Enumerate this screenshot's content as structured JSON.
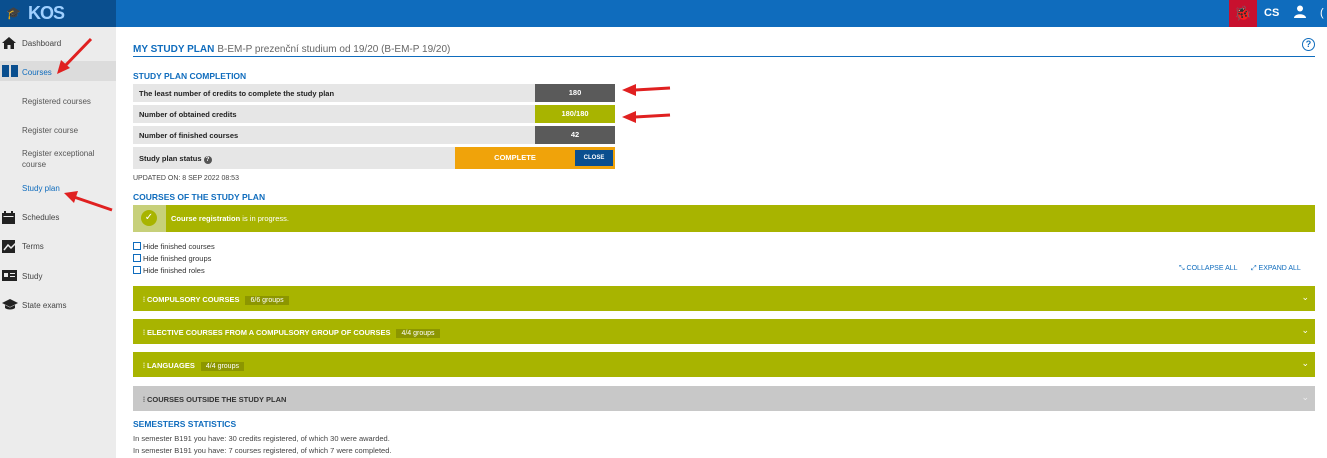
{
  "app": {
    "logo": "KOS"
  },
  "topbar": {
    "lang": "CS"
  },
  "sidebar": {
    "items": [
      {
        "label": "Dashboard",
        "icon": "home-icon"
      },
      {
        "label": "Courses",
        "icon": "book-icon"
      },
      {
        "label": "Schedules",
        "icon": "calendar-icon"
      },
      {
        "label": "Terms",
        "icon": "chart-icon"
      },
      {
        "label": "Study",
        "icon": "id-card-icon"
      },
      {
        "label": "State exams",
        "icon": "graduation-cap-icon"
      }
    ],
    "sub": [
      "Registered courses",
      "Register course",
      "Register exceptional course",
      "Study plan"
    ]
  },
  "page": {
    "title": "MY STUDY PLAN",
    "subtitle": "B-EM-P prezenční studium od 19/20 (B-EM-P 19/20)"
  },
  "completion": {
    "heading": "STUDY PLAN COMPLETION",
    "rows": [
      {
        "label": "The least number of credits to complete the study plan",
        "value": "180"
      },
      {
        "label": "Number of obtained credits",
        "value": "180/180"
      },
      {
        "label": "Number of finished courses",
        "value": "42"
      }
    ],
    "status_label": "Study plan status",
    "status_value": "COMPLETE",
    "close_label": "CLOSE",
    "updated": "UPDATED ON: 8 SEP 2022 08:53"
  },
  "courses": {
    "heading": "COURSES OF THE STUDY PLAN",
    "banner_bold": "Course registration",
    "banner_rest": " is in progress.",
    "filters": [
      "Hide finished courses",
      "Hide finished groups",
      "Hide finished roles"
    ],
    "collapse_all": "COLLAPSE ALL",
    "expand_all": "EXPAND ALL",
    "groups": [
      {
        "title": "COMPULSORY COURSES",
        "badge": "6/6 groups"
      },
      {
        "title": "ELECTIVE COURSES FROM A COMPULSORY GROUP OF COURSES",
        "badge": "4/4 groups"
      },
      {
        "title": "LANGUAGES",
        "badge": "4/4 groups"
      },
      {
        "title": "COURSES OUTSIDE THE STUDY PLAN",
        "badge": ""
      }
    ]
  },
  "semesters": {
    "heading": "SEMESTERS STATISTICS",
    "lines": [
      "In semester B191 you have: 30 credits registered, of which 30 were awarded.",
      "In semester B191 you have: 7 courses registered, of which 7 were completed."
    ]
  },
  "colors": {
    "accent": "#0f6cbd",
    "olive": "#a8b400",
    "orange": "#f0a30a",
    "dark": "#5a5a5a"
  }
}
